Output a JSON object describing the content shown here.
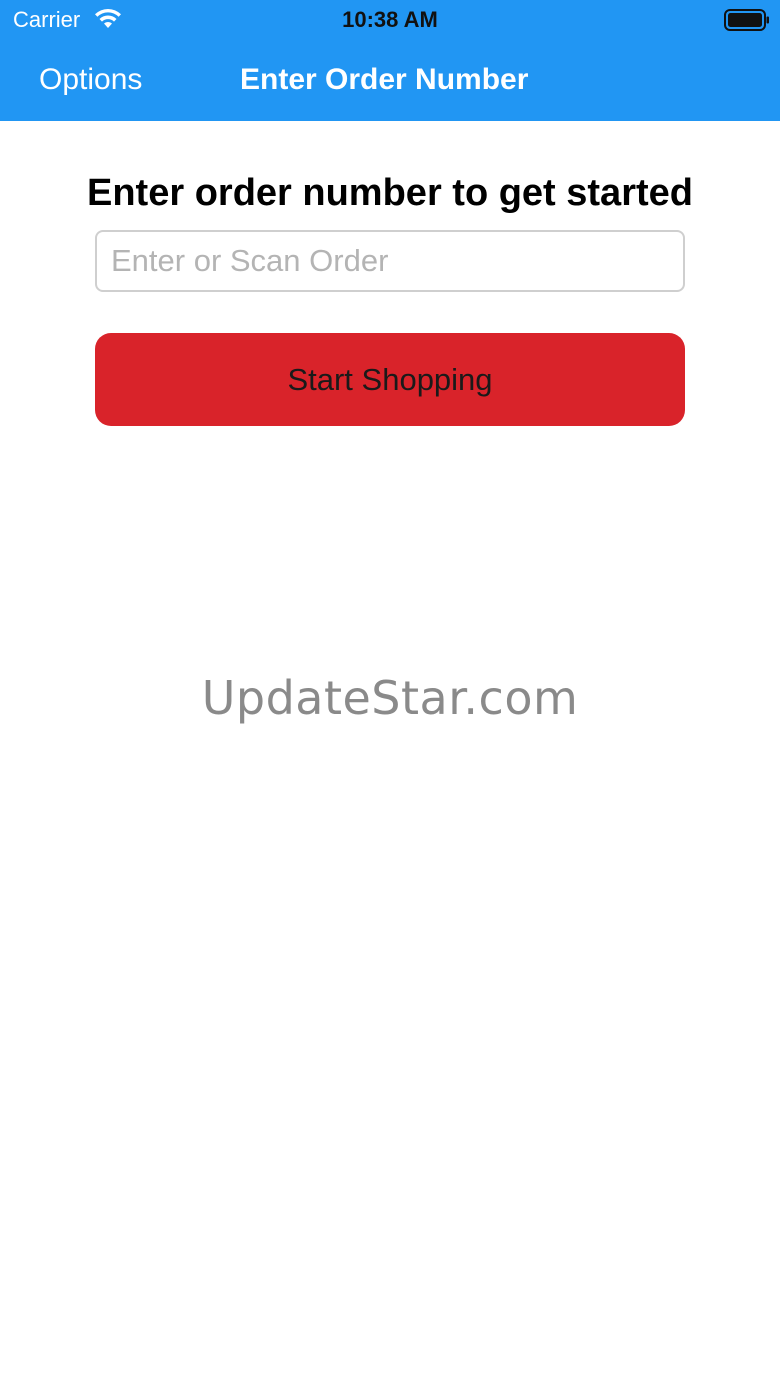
{
  "status_bar": {
    "carrier": "Carrier",
    "time": "10:38 AM",
    "wifi_icon": "wifi-icon",
    "battery_icon": "battery-full-icon"
  },
  "nav": {
    "left_button": "Options",
    "title": "Enter Order Number",
    "background_color": "#2196f3"
  },
  "main": {
    "headline": "Enter order number to get started",
    "order_input": {
      "value": "",
      "placeholder": "Enter or Scan Order"
    },
    "start_button": {
      "label": "Start Shopping",
      "color": "#d9232a"
    }
  },
  "watermark": "UpdateStar.com"
}
